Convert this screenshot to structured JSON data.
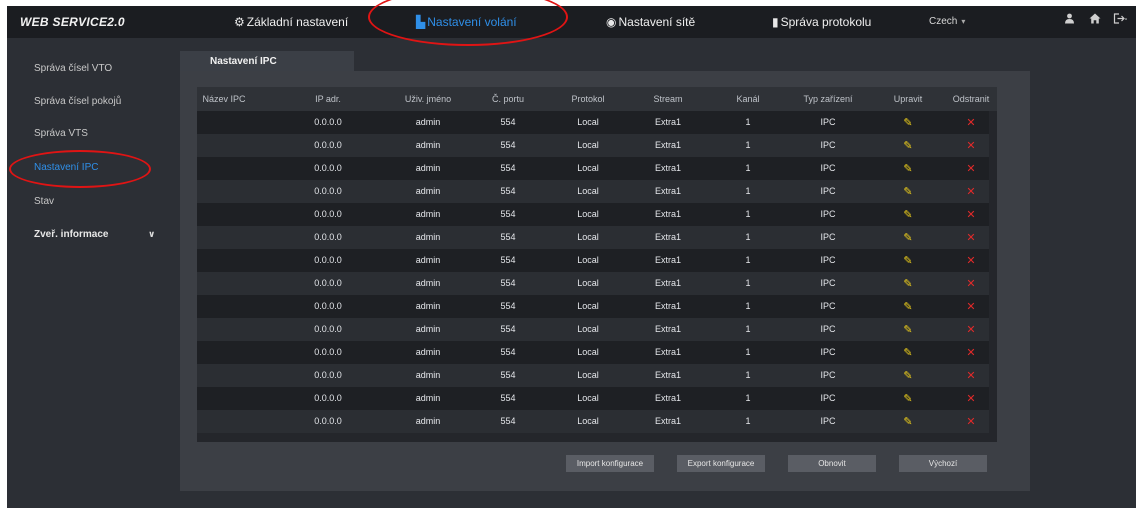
{
  "app": {
    "logo": "WEB SERVICE2.0"
  },
  "nav": {
    "items": [
      {
        "icon": "⚙",
        "label": "Základní nastavení"
      },
      {
        "icon": "▙",
        "label": "Nastavení volání"
      },
      {
        "icon": "◉",
        "label": "Nastavení sítě"
      },
      {
        "icon": "▮",
        "label": "Správa protokolu"
      }
    ],
    "language": "Czech"
  },
  "sidebar": {
    "items": [
      {
        "label": "Správa čísel VTO"
      },
      {
        "label": "Správa čísel pokojů"
      },
      {
        "label": "Správa VTS"
      },
      {
        "label": "Nastavení IPC"
      },
      {
        "label": "Stav"
      },
      {
        "label": "Zveř. informace"
      }
    ]
  },
  "tab": {
    "label": "Nastavení IPC"
  },
  "table": {
    "headers": [
      "Název IPC",
      "IP adr.",
      "Uživ. jméno",
      "Č. portu",
      "Protokol",
      "Stream",
      "Kanál",
      "Typ zařízení",
      "Upravit",
      "Odstranit"
    ],
    "rows": [
      [
        "",
        "0.0.0.0",
        "admin",
        "554",
        "Local",
        "Extra1",
        "1",
        "IPC"
      ],
      [
        "",
        "0.0.0.0",
        "admin",
        "554",
        "Local",
        "Extra1",
        "1",
        "IPC"
      ],
      [
        "",
        "0.0.0.0",
        "admin",
        "554",
        "Local",
        "Extra1",
        "1",
        "IPC"
      ],
      [
        "",
        "0.0.0.0",
        "admin",
        "554",
        "Local",
        "Extra1",
        "1",
        "IPC"
      ],
      [
        "",
        "0.0.0.0",
        "admin",
        "554",
        "Local",
        "Extra1",
        "1",
        "IPC"
      ],
      [
        "",
        "0.0.0.0",
        "admin",
        "554",
        "Local",
        "Extra1",
        "1",
        "IPC"
      ],
      [
        "",
        "0.0.0.0",
        "admin",
        "554",
        "Local",
        "Extra1",
        "1",
        "IPC"
      ],
      [
        "",
        "0.0.0.0",
        "admin",
        "554",
        "Local",
        "Extra1",
        "1",
        "IPC"
      ],
      [
        "",
        "0.0.0.0",
        "admin",
        "554",
        "Local",
        "Extra1",
        "1",
        "IPC"
      ],
      [
        "",
        "0.0.0.0",
        "admin",
        "554",
        "Local",
        "Extra1",
        "1",
        "IPC"
      ],
      [
        "",
        "0.0.0.0",
        "admin",
        "554",
        "Local",
        "Extra1",
        "1",
        "IPC"
      ],
      [
        "",
        "0.0.0.0",
        "admin",
        "554",
        "Local",
        "Extra1",
        "1",
        "IPC"
      ],
      [
        "",
        "0.0.0.0",
        "admin",
        "554",
        "Local",
        "Extra1",
        "1",
        "IPC"
      ],
      [
        "",
        "0.0.0.0",
        "admin",
        "554",
        "Local",
        "Extra1",
        "1",
        "IPC"
      ]
    ],
    "edit_icon": "pencil-icon",
    "delete_icon": "close-icon"
  },
  "buttons": {
    "import": "Import konfigurace",
    "export": "Export konfigurace",
    "refresh": "Obnovit",
    "default": "Výchozí"
  },
  "colors": {
    "accent": "#2f8fe8",
    "edit": "#f2d21b",
    "delete": "#e22a2a",
    "annotation": "#e01414"
  }
}
